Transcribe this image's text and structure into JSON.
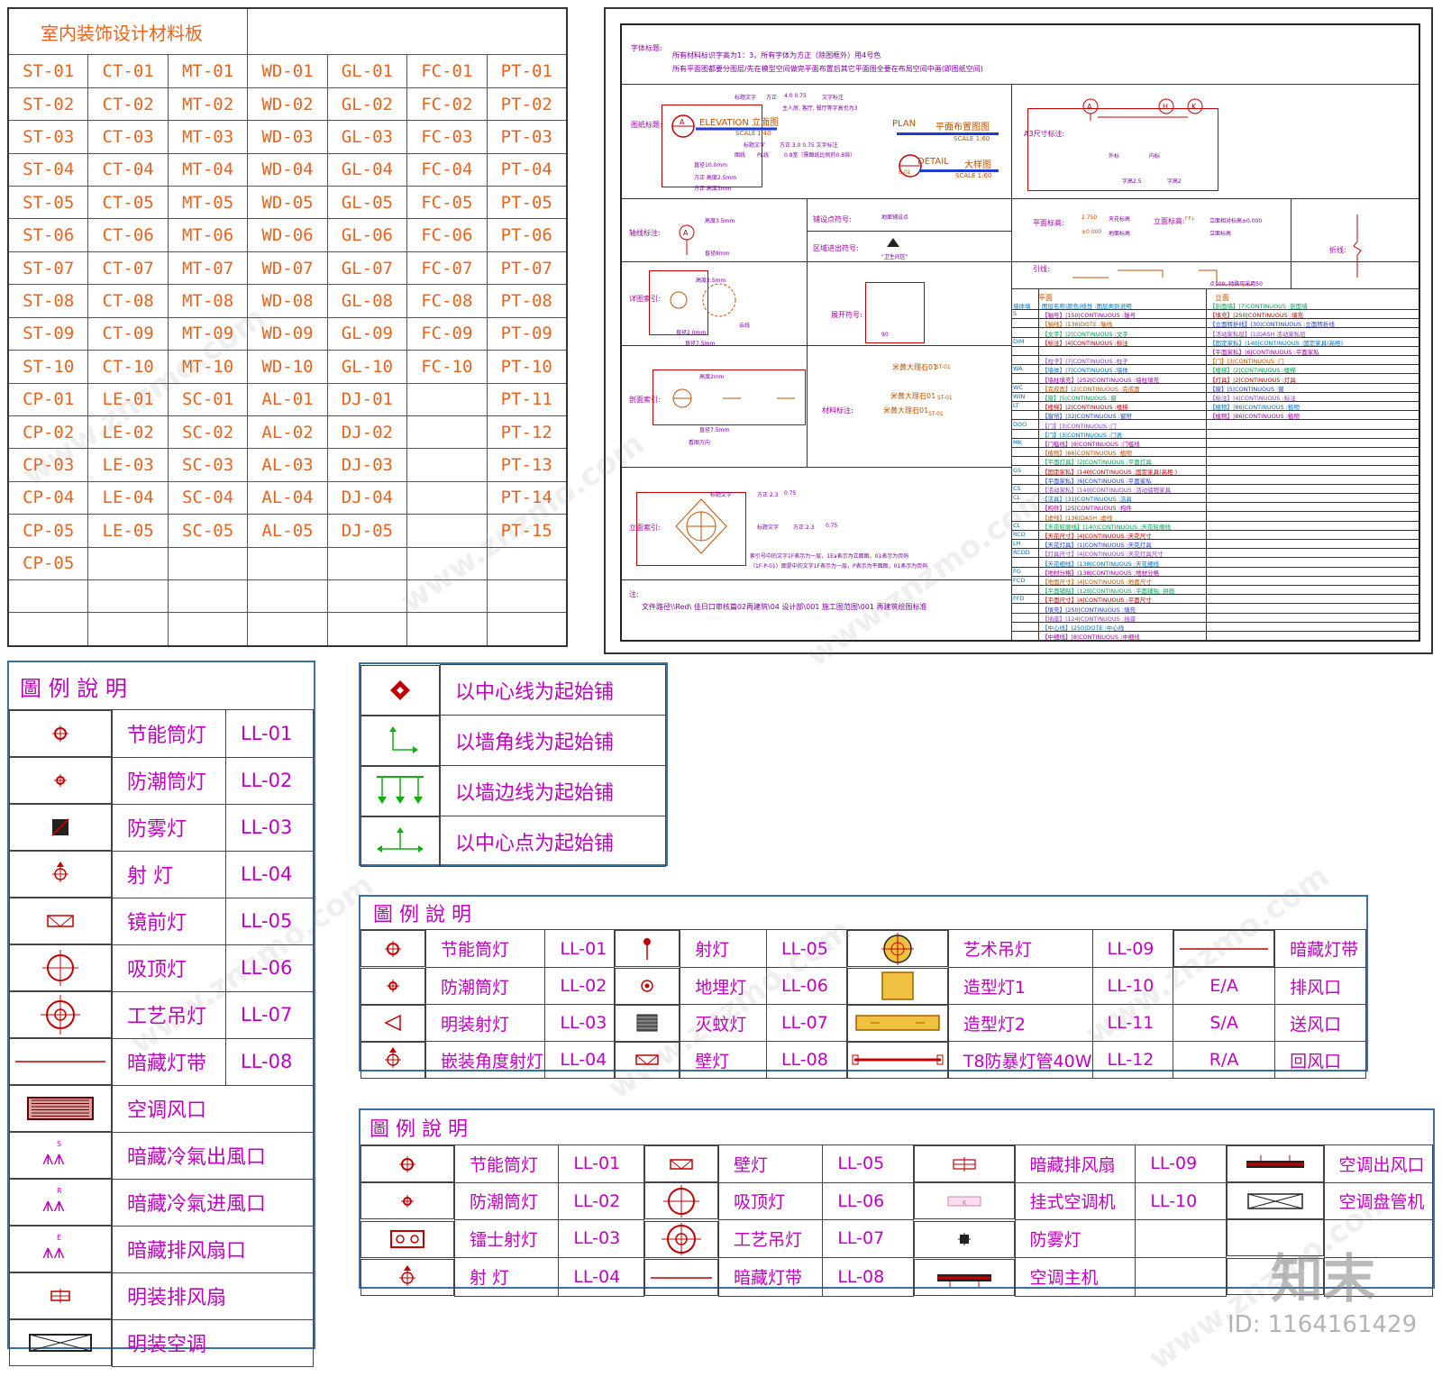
{
  "materials": {
    "title": "室内装饰设计材料板",
    "rows": [
      [
        "ST-01",
        "CT-01",
        "MT-01",
        "WD-01",
        "GL-01",
        "FC-01",
        "PT-01"
      ],
      [
        "ST-02",
        "CT-02",
        "MT-02",
        "WD-02",
        "GL-02",
        "FC-02",
        "PT-02"
      ],
      [
        "ST-03",
        "CT-03",
        "MT-03",
        "WD-03",
        "GL-03",
        "FC-03",
        "PT-03"
      ],
      [
        "ST-04",
        "CT-04",
        "MT-04",
        "WD-04",
        "GL-04",
        "FC-04",
        "PT-04"
      ],
      [
        "ST-05",
        "CT-05",
        "MT-05",
        "WD-05",
        "GL-05",
        "FC-05",
        "PT-05"
      ],
      [
        "ST-06",
        "CT-06",
        "MT-06",
        "WD-06",
        "GL-06",
        "FC-06",
        "PT-06"
      ],
      [
        "ST-07",
        "CT-07",
        "MT-07",
        "WD-07",
        "GL-07",
        "FC-07",
        "PT-07"
      ],
      [
        "ST-08",
        "CT-08",
        "MT-08",
        "WD-08",
        "GL-08",
        "FC-08",
        "PT-08"
      ],
      [
        "ST-09",
        "CT-09",
        "MT-09",
        "WD-09",
        "GL-09",
        "FC-09",
        "PT-09"
      ],
      [
        "ST-10",
        "CT-10",
        "MT-10",
        "WD-10",
        "GL-10",
        "FC-10",
        "PT-10"
      ],
      [
        "CP-01",
        "LE-01",
        "SC-01",
        "AL-01",
        "DJ-01",
        "",
        "PT-11"
      ],
      [
        "CP-02",
        "LE-02",
        "SC-02",
        "AL-02",
        "DJ-02",
        "",
        "PT-12"
      ],
      [
        "CP-03",
        "LE-03",
        "SC-03",
        "AL-03",
        "DJ-03",
        "",
        "PT-13"
      ],
      [
        "CP-04",
        "LE-04",
        "SC-04",
        "AL-04",
        "DJ-04",
        "",
        "PT-14"
      ],
      [
        "CP-05",
        "LE-05",
        "SC-05",
        "AL-05",
        "DJ-05",
        "",
        "PT-15"
      ],
      [
        "CP-05",
        "",
        "",
        "",
        "",
        "",
        ""
      ],
      [
        "",
        "",
        "",
        "",
        "",
        "",
        ""
      ],
      [
        "",
        "",
        "",
        "",
        "",
        "",
        ""
      ]
    ]
  },
  "cad": {
    "font_title": "字体标题:",
    "font_note1": "所有材料标识字高为1：3，所有字体为方正（除图框外）用4号色",
    "font_note2": "所有平面图都要分图层/先在模型空间做完平面布置后其它平面图全要在布局空间中画(即图纸空间)",
    "drawing_title": "图纸标题:",
    "elevation": "ELEVATION 立面图",
    "elev_scale": "SCALE",
    "elev_ratio": "1:40",
    "plan": "PLAN",
    "plan_cn": "平面布置图图",
    "plan_scale": "SCALE   1:60",
    "detail": "DETAIL",
    "detail_cn": "大样图",
    "detail_scale": "SCALE   1:60",
    "detail_tag": "E-01",
    "note_a1": "标题文字",
    "note_a2": "方正",
    "note_a3": "4.0  0.75",
    "note_a4": "文字标注",
    "note_b": "主人房, 客厅, 餐厅等字高也为3",
    "note_c1": "标题文字",
    "note_c2": "方正  3.0  0.75  文字标注",
    "note_c3": "图线",
    "note_c4": "PL线",
    "note_c5": "0.8宽（需图纸比例的0.8倍）",
    "note_d1": "直径10.0mm",
    "note_d2": "方正  高度2.5mm",
    "note_d3": "方正  高度3mm",
    "a3_label": "A3尺寸标注:",
    "a3_outer": "外标",
    "a3_inner": "内标",
    "a3_h1": "字高2.5",
    "a3_h2": "字高2",
    "axis_label": "轴线标注:",
    "axis_h": "高度3.5mm",
    "axis_d": "直径8mm",
    "paving_label": "铺设点符号:",
    "paving_text": "地面铺设点",
    "area_label": "区域进出符号:",
    "area_text": "\"卫生间区\"",
    "plan_elev_label": "平面标高:",
    "plan_elev_v1": "2.750",
    "plan_elev_t1": "天花标高",
    "plan_elev_v2": "±0.000",
    "plan_elev_t2": "地面标高",
    "elev_label": "立面标高:",
    "elev_t1": "F.F.L",
    "elev_t2": "立面相对标高±0.000",
    "elev_t3": "立面标高",
    "break_label": "折线:",
    "leader_label": "引线:",
    "leader_note": "点100, 特殊可采用50",
    "detail_idx_label": "详图索引:",
    "detail_idx_h": "高度2.5mm",
    "detail_idx_d1": "直径2.0mm",
    "detail_idx_d2": "直径7.5mm",
    "cloud": "云线",
    "section_label": "剖面索引:",
    "section_h": "高度2mm",
    "section_d": "直径7.5mm",
    "section_dir": "看图方向",
    "unfold_label": "展开符号:",
    "unfold_angle": "90",
    "material_label": "材料标注:",
    "material_name": "米黄大理石01",
    "material_tag": "ST-01",
    "elev_idx_label": "立面索引:",
    "elev_idx_t1": "标题文字",
    "elev_idx_t2": "方正  2.3",
    "elev_idx_t3": "0.75",
    "elev_idx_note1": "索引号中的文字1F表示为一层，1Ea表示为立面图，01表示为页码",
    "elev_idx_note2": "（1F-P-01）图是中的文字1F表示为一层，P表示为平面图，01表示为页码",
    "footer_note": "注:",
    "footer_path": "文件路径\\\\Red\\ 佳日口审核篇02再建筑\\04 设计部\\001 施工图范图\\001 再建筑绘图标准",
    "layer_h_plan": "平面",
    "layer_h_elev": "立面"
  },
  "layers": [
    {
      "code": "墙体填",
      "plan": "图层名称|颜色|线性      :图层类别说明",
      "elev": "【剖面墙】|7|CONTINUOUS  :剖面墙"
    },
    {
      "code": "S",
      "plan": "【轴号】|150|CONTINUOUS      :轴号",
      "elev": "【填充】|250|CONTINUOUS  :填充"
    },
    {
      "code": "",
      "plan": "【轴线】|136|DOTE :轴线",
      "elev": "【立面转折线】|30|CONTINUOUS  :立面转折线"
    },
    {
      "code": "",
      "plan": "【文字】|2|CONTINUOUS    :文字",
      "elev": "【活动家私层】|1|DASH        活动家私层"
    },
    {
      "code": "DIM",
      "plan": "【标注】|4|CONTINUOUS     :标注",
      "elev": "【固定家私】|140|CONTINUOUS  :固定家具(高柜)"
    },
    {
      "code": "",
      "plan": "",
      "elev": "【平面家私】|6|CONTINUOUS  :平面家私"
    },
    {
      "code": "",
      "plan": "【柱子】|7|CONTINUOUS      :柱子",
      "elev": "【门】|3|CONTINUOUS  :门"
    },
    {
      "code": "WA",
      "plan": "【墙体】|7|CONTINUOUS      :墙体",
      "elev": "【楼梯】|2|CONTINUOUS  :楼梯"
    },
    {
      "code": "",
      "plan": "【墙柱填充】|252|CONTINUOUS :墙柱填充",
      "elev": "【灯具】|2|CONTINUOUS  :灯具"
    },
    {
      "code": "WC",
      "plan": "【完成面】|2|CONTINUOUS   :完成面",
      "elev": "【窗】|5|CONTINUOUS  :窗"
    },
    {
      "code": "WIN",
      "plan": "【窗】|5|CONTINUOUS       :窗",
      "elev": "【标注】|4|CONTINUOUS  :标注"
    },
    {
      "code": "LT",
      "plan": "【楼梯】|2|CONTINUOUS      :楼梯",
      "elev": "【植物】|86|CONTINUOUS  :植物"
    },
    {
      "code": "",
      "plan": "【窗帘】|32|CONTINUOUS     :窗帘",
      "elev": "【植物】|86|CONTINUOUS  :植物"
    },
    {
      "code": "DOO",
      "plan": "【门】|3|CONTINUOUS       :门",
      "elev": ""
    },
    {
      "code": "",
      "plan": "【门】|3|CONTINUOUS       :门表",
      "elev": ""
    },
    {
      "code": "MK",
      "plan": "【门槛线】|8|CONTINUOUS :门槛线",
      "elev": ""
    },
    {
      "code": "",
      "plan": "【植物】|86|CONTINUOUS     :植物",
      "elev": ""
    },
    {
      "code": "",
      "plan": "【平面灯具】|2|CONTINUOUS  :平面灯具",
      "elev": ""
    },
    {
      "code": "GS",
      "plan": "【固定家私】|140|CONTINUOUS :固定家具(高柜 )",
      "elev": ""
    },
    {
      "code": "",
      "plan": "【平面家私】|6|CONTINUOUS   :平面家私",
      "elev": ""
    },
    {
      "code": "CS",
      "plan": "【活动家私】|140|CONTINUOUS :活动储物家具",
      "elev": ""
    },
    {
      "code": "CL",
      "plan": "【洁具】|31|CONTINUOUS     :洁具",
      "elev": ""
    },
    {
      "code": "",
      "plan": "【构件】|25|CONTINUOUS     :构件",
      "elev": ""
    },
    {
      "code": "",
      "plan": "【虚线】|136|DASH          :虚线",
      "elev": ""
    },
    {
      "code": "CL",
      "plan": "【天花轮廓线】|140|CONTINUOUS :天花轮廓线",
      "elev": ""
    },
    {
      "code": "RCD",
      "plan": "【天花尺寸】|4|CONTINUOUS  :天花尺寸",
      "elev": ""
    },
    {
      "code": "LH",
      "plan": "【天花灯具】|1|CONTINUOUS   :天花灯具",
      "elev": ""
    },
    {
      "code": "RCDD",
      "plan": "【灯具尺寸】|4|CONTINUOUS :天花灯具尺寸",
      "elev": ""
    },
    {
      "code": "",
      "plan": "【天花细线】|138|CONTINUOUS :天花细线",
      "elev": ""
    },
    {
      "code": "FG",
      "plan": "【地材分格】|138|CONTINUOUS :地材分格",
      "elev": ""
    },
    {
      "code": "FCD",
      "plan": "【地面尺寸】|4|CONTINUOUS  :地面尺寸",
      "elev": ""
    },
    {
      "code": "",
      "plan": "【平面铺贴】|120|CONTINUOUS :平面铺贴, 拼画",
      "elev": ""
    },
    {
      "code": "FFD",
      "plan": "【平面尺寸】|4|CONTINUOUS  :平面尺寸",
      "elev": ""
    },
    {
      "code": "",
      "plan": "【填充】|250|CONTINUOUS  :填充",
      "elev": ""
    },
    {
      "code": "",
      "plan": "【插座】|124|CONTINUOUS  :插座",
      "elev": ""
    },
    {
      "code": "",
      "plan": "【中心线】|250|DOTE     :中心线",
      "elev": ""
    },
    {
      "code": "",
      "plan": "【中细线】|8|CONTINUOUS  :中细线",
      "elev": ""
    }
  ],
  "legend1": {
    "title": "圖  例  說  明",
    "rows": [
      {
        "icon": "downlight-icon",
        "name": "节能筒灯",
        "code": "LL-01"
      },
      {
        "icon": "moisture-light-icon",
        "name": "防潮筒灯",
        "code": "LL-02"
      },
      {
        "icon": "fog-light-icon",
        "name": "防雾灯",
        "code": "LL-03"
      },
      {
        "icon": "spot-light-icon",
        "name": "射  灯",
        "code": "LL-04"
      },
      {
        "icon": "mirror-light-icon",
        "name": "镜前灯",
        "code": "LL-05"
      },
      {
        "icon": "ceiling-light-icon",
        "name": "吸顶灯",
        "code": "LL-06"
      },
      {
        "icon": "chandelier-icon",
        "name": "工艺吊灯",
        "code": "LL-07"
      },
      {
        "icon": "light-strip-icon",
        "name": "暗藏灯带",
        "code": "LL-08"
      },
      {
        "icon": "ac-vent-icon",
        "name": "空调风口",
        "code": ""
      },
      {
        "icon": "supply-vent-icon",
        "name": "暗藏冷氣出風口",
        "code": ""
      },
      {
        "icon": "return-vent-icon",
        "name": "暗藏冷氣进風口",
        "code": ""
      },
      {
        "icon": "exhaust-vent-icon",
        "name": "暗藏排风扇口",
        "code": ""
      },
      {
        "icon": "exhaust-fan-icon",
        "name": "明装排风扇",
        "code": ""
      },
      {
        "icon": "ac-unit-icon",
        "name": "明装空调",
        "code": ""
      }
    ]
  },
  "paving": {
    "rows": [
      {
        "icon": "center-line-icon",
        "text": "以中心线为起始铺"
      },
      {
        "icon": "wall-corner-icon",
        "text": "以墙角线为起始铺"
      },
      {
        "icon": "wall-edge-icon",
        "text": "以墙边线为起始铺"
      },
      {
        "icon": "center-point-icon",
        "text": "以中心点为起始铺"
      }
    ]
  },
  "legend2": {
    "title": "圖  例  說  明",
    "rows": [
      [
        "节能筒灯",
        "LL-01",
        "射灯",
        "LL-05",
        "艺术吊灯",
        "LL-09",
        "",
        "暗藏灯带"
      ],
      [
        "防潮筒灯",
        "LL-02",
        "地埋灯",
        "LL-06",
        "造型灯1",
        "LL-10",
        "E/A",
        "排风口"
      ],
      [
        "明装射灯",
        "LL-03",
        "灭蚊灯",
        "LL-07",
        "造型灯2",
        "LL-11",
        "S/A",
        "送风口"
      ],
      [
        "嵌装角度射灯",
        "LL-04",
        "壁灯",
        "LL-08",
        "T8防暴灯管40W",
        "LL-12",
        "R/A",
        "回风口"
      ]
    ]
  },
  "legend3": {
    "title": "圖  例  說  明",
    "rows": [
      [
        "节能筒灯",
        "LL-01",
        "壁灯",
        "LL-05",
        "暗藏排风扇",
        "LL-09",
        "空调出风口"
      ],
      [
        "防潮筒灯",
        "LL-02",
        "吸顶灯",
        "LL-06",
        "挂式空调机",
        "LL-10",
        "空调盘管机"
      ],
      [
        "镭士射灯",
        "LL-03",
        "工艺吊灯",
        "LL-07",
        "防雾灯",
        "",
        ""
      ],
      [
        "射  灯",
        "LL-04",
        "暗藏灯带",
        "LL-08",
        "空调主机",
        "",
        ""
      ]
    ]
  },
  "watermark": {
    "site": "www.znzmo.com",
    "logo": "知末",
    "id": "ID: 1164161429"
  },
  "colors": {
    "orange": "#e8641e",
    "magenta": "#c000c0",
    "red": "#c00000",
    "border_blue": "#3a6ea5"
  }
}
